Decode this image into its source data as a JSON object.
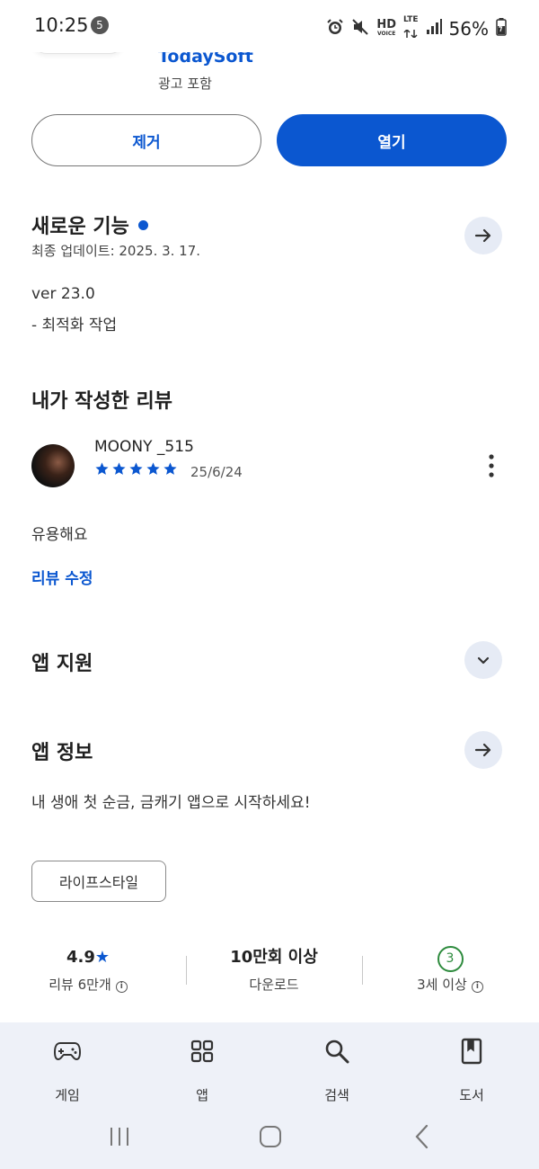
{
  "status_bar": {
    "time": "10:25",
    "notification_count": "5",
    "hd_label": "HD",
    "voice_label": "VOICE",
    "lte_label": "LTE",
    "battery": "56%"
  },
  "app": {
    "developer": "TodaySoft",
    "ads_note": "광고 포함",
    "remove_label": "제거",
    "open_label": "열기"
  },
  "whats_new": {
    "title": "새로운 기능",
    "last_updated": "최종 업데이트: 2025. 3. 17.",
    "version": "ver 23.0",
    "note": "- 최적화 작업"
  },
  "my_review": {
    "title": "내가 작성한 리뷰",
    "reviewer": "MOONY _515",
    "rating": 5,
    "date": "25/6/24",
    "text": "유용해요",
    "edit_label": "리뷰 수정"
  },
  "app_support": {
    "title": "앱 지원"
  },
  "app_info": {
    "title": "앱 정보",
    "description": "내 생애 첫 순금, 금캐기 앱으로 시작하세요!",
    "category": "라이프스타일"
  },
  "stats": {
    "rating_value": "4.9",
    "rating_label": "리뷰 6만개",
    "downloads_value": "10만회 이상",
    "downloads_label": "다운로드",
    "age_value": "3",
    "age_label": "3세 이상"
  },
  "bottom_nav": [
    {
      "label": "게임",
      "icon": "gamepad-icon"
    },
    {
      "label": "앱",
      "icon": "apps-grid-icon"
    },
    {
      "label": "검색",
      "icon": "search-icon"
    },
    {
      "label": "도서",
      "icon": "book-icon"
    }
  ],
  "colors": {
    "accent": "#0b57d0",
    "nav_bg": "#eef1f8",
    "age_green": "#2e8b3e"
  }
}
